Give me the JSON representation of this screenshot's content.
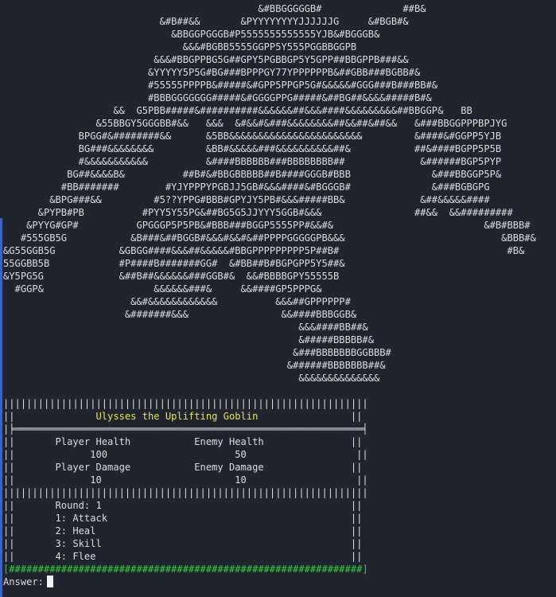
{
  "ascii_art": [
    "                                            &#BBGGGGGB#              ##B&",
    "                           &#B##&&       &PYYYYYYYYJJJJJJG     &#BGB#&",
    "                             &BBGGPGGGB#P5555555555555YJB&#BGGGB&",
    "                               &&&#BGBB5555GGPP5Y555PGGBBGGPB",
    "                          &&&#BBGPPBG5G##GPY5PGBBGP5Y5GPP##BBGPPB###&&",
    "                         &YYYYY5P5G#BG###BPPPGY77YPPPPPPB&##GBB###BGBB#&",
    "                         #55555PPPPB&#####&#GPP5PPGP5G#&&&&&#GGG###B###BB#&",
    "                         #BBBGGGGGGG#####&#GGGGPPG#####&##BG##&&&&#####B#&",
    "                   &&  G5PBB#####&##########&&&&&&##&&&####&&&&&&&&&##BBGGP&   BB",
    "                &55BBGY5GGGBB#&&   &&&  &#&&#&###&&&&&&&&##&&##&##&&   &###BBGGPPPBPJYG",
    "             BPGG#&########&&      &5BB&&&&&&&&&&&&&&&&&&&&&&&         &####&#GGPP5YJB",
    "             BG###&&&&&&&&         &BB#&&&&&###&&&&&&&&&&##&           ##&####BGPP5P5B",
    "             #&&&&&&&&&&&          &####BBBBBB###BBBBBBBB##             &######BGP5PYP",
    "           BG##&&&&B&          ##B#&#BBGBBBBB##B####GGGB#BBB              &###BBGGP5P&",
    "          #BB#######        #YJYPPPYPGBJJ5GB#&&&####&#BGGGB#              &###BGBGPG",
    "        &BPG###&&         #5??YPPG#BBB#GPYJY5PB#&&&#####BB&             &##&&&&&####",
    "      &PYPB#PB          #PYY5Y55PG&##BG5G5JJYYY5GGB#&&&                ##&&  &&#########",
    "    &PYYG#GP#          GPGGGP5P5PB&#BBB###BGGP5555PP#&&#&                          &#B#BBB#",
    "   #555GB5G           &B###&##BGGB#&&&#&&#&##PPPPGGGGGPB&&&                           &BBB#&",
    "&G55GGB5G           &GBGG####&&&##&&&&&#BBGPPPPPPPPP5P##B#                             #B&",
    "55GGBB5B            #P####B#######GG#  &#BB##B#BGPGPP5Y5##&",
    "&Y5PG5G             &##B##&&&&&&###GGB#&  &&#BBBBGPY55555B",
    "  #GGP&                   &&&&&&###&     &&####GP5PPPG&",
    "                      &&#&&&&&&&&&&&&          &&&##GPPPPPP#",
    "                     &#######&&&                &&####BBBGGB&",
    "                                                   &&&####BB##&",
    "                                                   &#####BBBBB#&",
    "                                                  &###BBBBBBBGGBBB#",
    "                                                 &######BBBBBBB##&",
    "                                                   &&&&&&&&&&&&&&"
  ],
  "panel": {
    "top_border": "|||||||||||||||||||||||||||||||||||||||||||||||||||||||||||||||",
    "title_left": "||              ",
    "title": "Ulysses the Uplifting Goblin",
    "title_right": "                ||",
    "title_underline": "|╞════════════════════════════════════════════════════════════╡",
    "header_row": "||       Player Health           Enemy Health               ||",
    "health_row": "||             100                      50                   ||",
    "damage_header_row": "||       Player Damage           Enemy Damage               ||",
    "damage_row": "||             10                       10                   ||",
    "divider": "|||||||||||||||||||||||||||||||||||||||||||||||||||||||||||||||",
    "round_row": "||       Round: 1                                           ||",
    "options": [
      "||       1: Attack                                          ||",
      "||       2: Heal                                            ||",
      "||       3: Skill                                           ||",
      "||       4: Flee                                            ||"
    ],
    "progress_bar": "[#############################################################]"
  },
  "prompt": {
    "label": "Answer:"
  },
  "colors": {
    "background": "#20242e",
    "text": "#dcdcdc",
    "title": "#e7e74a",
    "progress": "#2ed03c",
    "accent_bar": "#3b62c7"
  }
}
